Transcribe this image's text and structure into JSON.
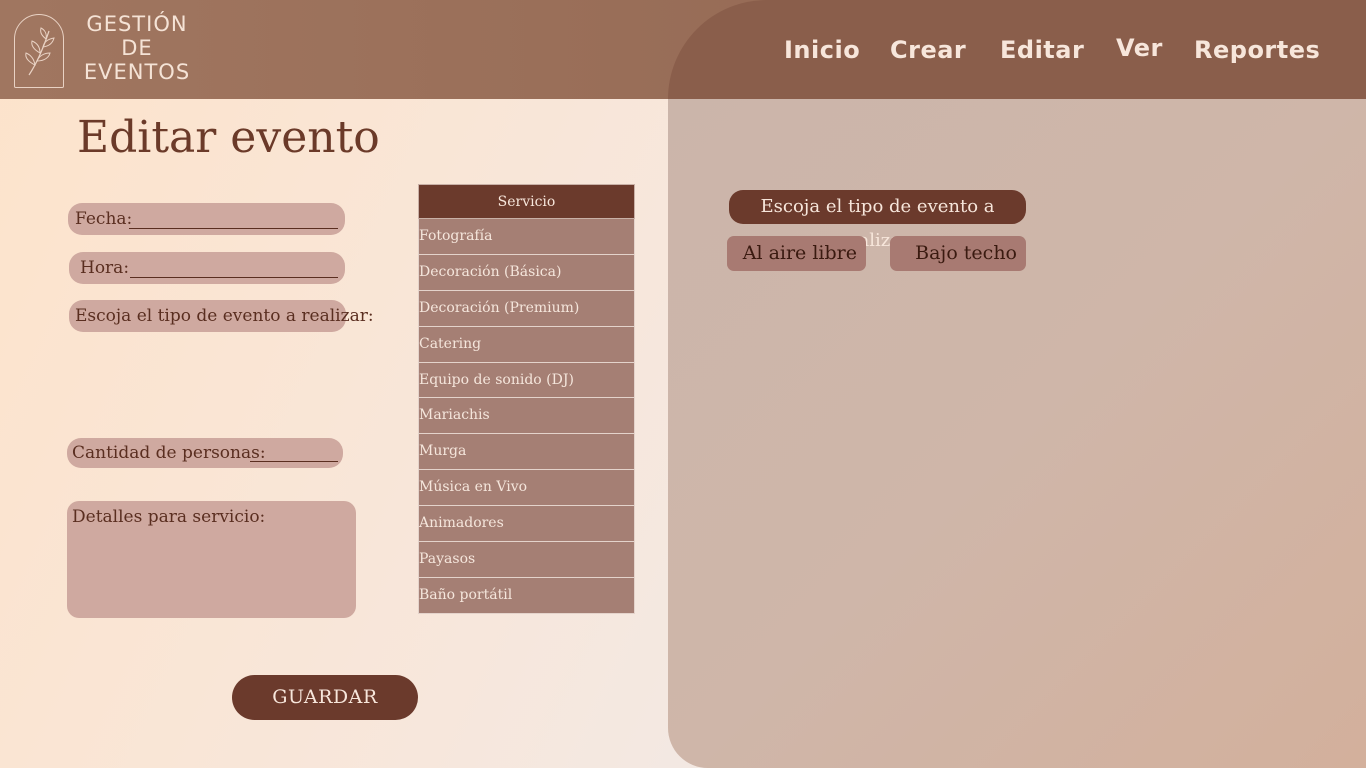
{
  "brand": {
    "logo_text": "GESTIÓN DE EVENTOS",
    "line1": "GESTIÓN",
    "line2": "DE",
    "line3": "EVENTOS"
  },
  "nav": {
    "items": [
      "Inicio",
      "Crear",
      "Editar",
      "Ver",
      "Reportes"
    ]
  },
  "page": {
    "title": "Editar evento"
  },
  "form": {
    "fecha_label": "Fecha:",
    "hora_label": "Hora:",
    "tipo_label": "Escoja el tipo de evento a realizar:",
    "cantidad_label": "Cantidad de personas:",
    "detalles_label": "Detalles para servicio:",
    "save_label": "GUARDAR"
  },
  "services": {
    "header": "Servicio",
    "rows": [
      "Fotografía",
      "Decoración (Básica)",
      "Decoración (Premium)",
      "Catering",
      "Equipo de sonido (DJ)",
      "Mariachis",
      "Murga",
      "Música en Vivo",
      "Animadores",
      "Payasos",
      "Baño portátil"
    ]
  },
  "event_type": {
    "label": "Escoja el tipo de evento a realizar:",
    "options": [
      "Al aire libre",
      "Bajo techo"
    ]
  },
  "colors": {
    "accent": "#6b3a2c",
    "header": "#8a5e4b",
    "pill": "#cfa9a0",
    "row": "#a57f74"
  },
  "icons": {
    "logo": "leaf-branch-icon"
  }
}
